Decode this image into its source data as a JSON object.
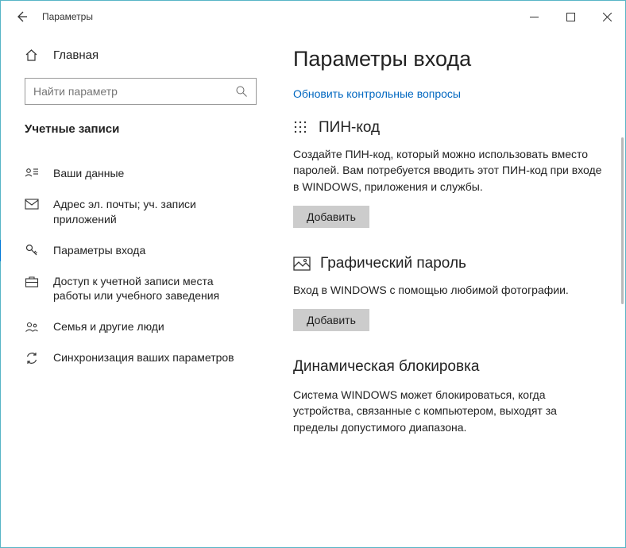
{
  "window": {
    "title": "Параметры"
  },
  "sidebar": {
    "home": "Главная",
    "search_placeholder": "Найти параметр",
    "section": "Учетные записи",
    "items": [
      {
        "label": "Ваши данные"
      },
      {
        "label": "Адрес эл. почты; уч. записи приложений"
      },
      {
        "label": "Параметры входа"
      },
      {
        "label": "Доступ к учетной записи места работы или учебного заведения"
      },
      {
        "label": "Семья и другие люди"
      },
      {
        "label": "Синхронизация ваших параметров"
      }
    ]
  },
  "content": {
    "title": "Параметры входа",
    "update_link": "Обновить контрольные вопросы",
    "pin": {
      "title": "ПИН-код",
      "desc": "Создайте ПИН-код, который можно использовать вместо паролей. Вам потребуется вводить этот ПИН-код при входе в WINDOWS, приложения и службы.",
      "button": "Добавить"
    },
    "picture": {
      "title": "Графический пароль",
      "desc": "Вход в WINDOWS с помощью любимой фотографии.",
      "button": "Добавить"
    },
    "dynlock": {
      "title": "Динамическая блокировка",
      "desc": "Система WINDOWS может блокироваться, когда устройства, связанные с компьютером, выходят за пределы допустимого диапазона."
    }
  }
}
